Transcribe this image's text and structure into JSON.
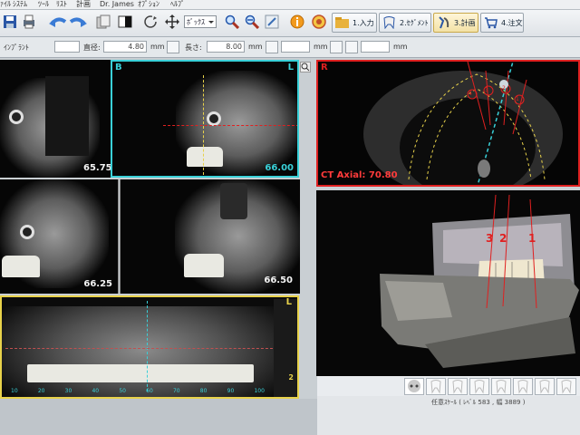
{
  "menu": [
    "ﾌｧｲﾙ",
    "ｼｽﾃﾑ",
    "ﾂｰﾙ",
    "ﾘｽﾄ",
    "計画",
    "Dr. James",
    "ｵﾌﾟｼｮﾝ",
    "ﾍﾙﾌﾟ"
  ],
  "toolbar": {
    "mode_select": "ﾎﾞｯｸｽ",
    "steps": [
      {
        "label": "1.入力",
        "active": false
      },
      {
        "label": "2.ｾｸﾞﾒﾝﾄ",
        "active": false
      },
      {
        "label": "3.計画",
        "active": true
      },
      {
        "label": "4.注文",
        "active": false
      }
    ]
  },
  "params": {
    "implant_label": "ｲﾝﾌﾟﾗﾝﾄ",
    "diameter_label": "直径:",
    "diameter_value": "4.80",
    "unit1": "mm",
    "length_label": "長さ:",
    "length_value": "8.00",
    "unit2": "mm",
    "unit3": "mm",
    "unit4": "mm"
  },
  "views": {
    "view1_value": "65.75",
    "view2_label_left": "B",
    "view2_label_right": "L",
    "view2_value": "66.00",
    "view3_value": "66.25",
    "view4_value": "66.50",
    "axial_label_left": "R",
    "axial_title": "CT Axial: 70.80",
    "axial_markers": [
      "4",
      "3",
      "2",
      "1"
    ],
    "panoramic_label_right": "L",
    "panoramic_side_label": "2",
    "panoramic_ruler": [
      "10",
      "20",
      "30",
      "40",
      "50",
      "60",
      "70",
      "80",
      "90",
      "100"
    ],
    "model_numbers": [
      "3",
      "2",
      "1"
    ]
  },
  "status": {
    "line1": "任意ｽｹｰﾙ ( ﾚﾍﾞﾙ 583 , 幅 3889 )"
  },
  "colors": {
    "accent_cyan": "#39d0d8",
    "accent_red": "#e02020",
    "accent_yellow": "#e8d24a",
    "toolbar_bg": "#e4e8eb"
  },
  "icons": [
    "floppy-icon",
    "print-icon",
    "undo-icon",
    "redo-icon",
    "copy-icon",
    "contrast-icon",
    "rotate-icon",
    "move-icon",
    "zoom-icon",
    "zoom-out-icon",
    "info-icon",
    "help-icon"
  ]
}
